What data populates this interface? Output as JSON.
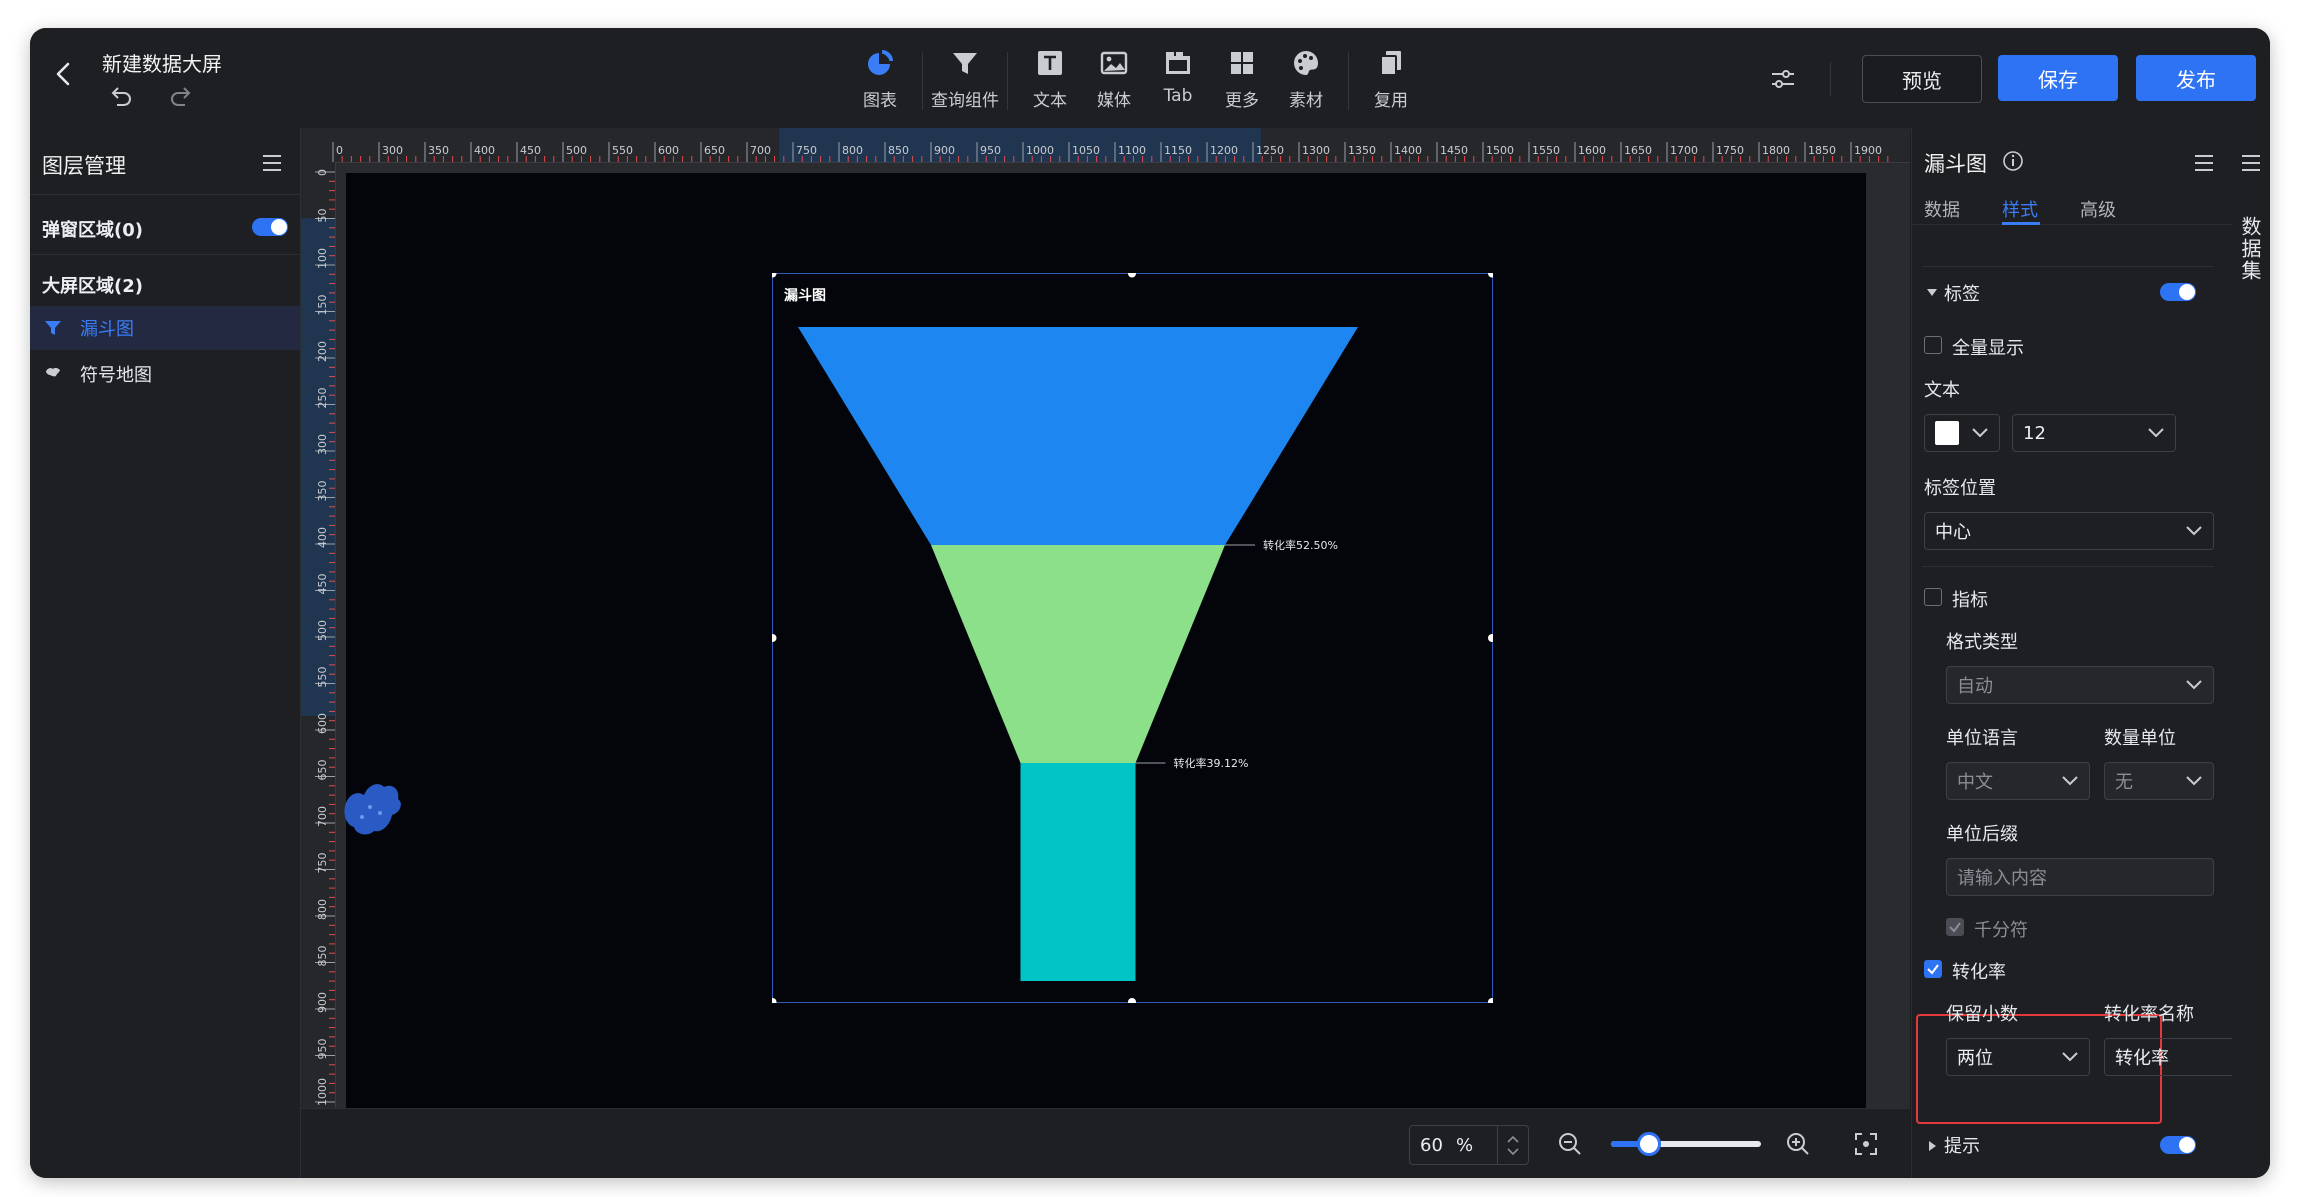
{
  "header": {
    "title": "新建数据大屏",
    "toolbar": [
      {
        "label": "图表",
        "icon": "pie-chart-icon"
      },
      {
        "label": "查询组件",
        "icon": "filter-icon"
      },
      {
        "label": "文本",
        "icon": "text-icon"
      },
      {
        "label": "媒体",
        "icon": "image-icon"
      },
      {
        "label": "Tab",
        "icon": "tab-icon"
      },
      {
        "label": "更多",
        "icon": "grid-icon"
      },
      {
        "label": "素材",
        "icon": "palette-icon"
      },
      {
        "label": "复用",
        "icon": "copy-icon"
      }
    ],
    "preview_label": "预览",
    "save_label": "保存",
    "publish_label": "发布"
  },
  "layers": {
    "title": "图层管理",
    "popup_section": "弹窗区域(0)",
    "screen_section": "大屏区域(2)",
    "items": [
      {
        "label": "漏斗图",
        "icon": "funnel-icon",
        "active": true
      },
      {
        "label": "符号地图",
        "icon": "map-icon",
        "active": false
      }
    ]
  },
  "ruler": {
    "h_ticks": [
      "0",
      "300",
      "350",
      "400",
      "450",
      "500",
      "550",
      "600",
      "650",
      "700",
      "750",
      "800",
      "850",
      "900",
      "950",
      "1000",
      "1050",
      "1100",
      "1150",
      "1200",
      "1250",
      "1300",
      "1350",
      "1400",
      "1450",
      "1500",
      "1550",
      "1600",
      "1650",
      "1700",
      "1750",
      "1800",
      "1850",
      "1900"
    ],
    "v_ticks": [
      "0",
      "50",
      "100",
      "150",
      "200",
      "250",
      "300",
      "350",
      "400",
      "450",
      "500",
      "550",
      "600",
      "650",
      "700",
      "750",
      "800",
      "850",
      "900",
      "950",
      "1000"
    ]
  },
  "widget": {
    "title": "漏斗图",
    "labels": [
      "转化率52.50%",
      "转化率39.12%"
    ]
  },
  "chart_data": {
    "type": "funnel",
    "stages": [
      {
        "value": 100,
        "color": "#1e86f0"
      },
      {
        "value": 52.5,
        "color": "#8ce08a"
      },
      {
        "value": 20.54,
        "color": "#00c4c6"
      }
    ],
    "conversion_rates": [
      "52.50%",
      "39.12%"
    ]
  },
  "zoom": {
    "value": "60",
    "unit": "%",
    "level": 0.25
  },
  "props": {
    "title": "漏斗图",
    "tabs": [
      "数据",
      "样式",
      "高级"
    ],
    "active_tab": 1,
    "label_section": "标签",
    "show_all": "全量显示",
    "text_label": "文本",
    "font_size": "12",
    "label_pos_label": "标签位置",
    "label_pos_value": "中心",
    "metric_label": "指标",
    "format_type_label": "格式类型",
    "format_type_value": "自动",
    "unit_lang_label": "单位语言",
    "unit_lang_value": "中文",
    "num_unit_label": "数量单位",
    "num_unit_value": "无",
    "unit_suffix_label": "单位后缀",
    "unit_suffix_placeholder": "请输入内容",
    "thousands_label": "千分符",
    "conv_rate_label": "转化率",
    "decimals_label": "保留小数",
    "decimals_value": "两位",
    "conv_name_label": "转化率名称",
    "conv_name_value": "转化率",
    "tooltip_section": "提示"
  },
  "side_strip": {
    "label": "数据集"
  },
  "colors": {
    "accent": "#2f73f5",
    "highlight": "#e5393b"
  }
}
